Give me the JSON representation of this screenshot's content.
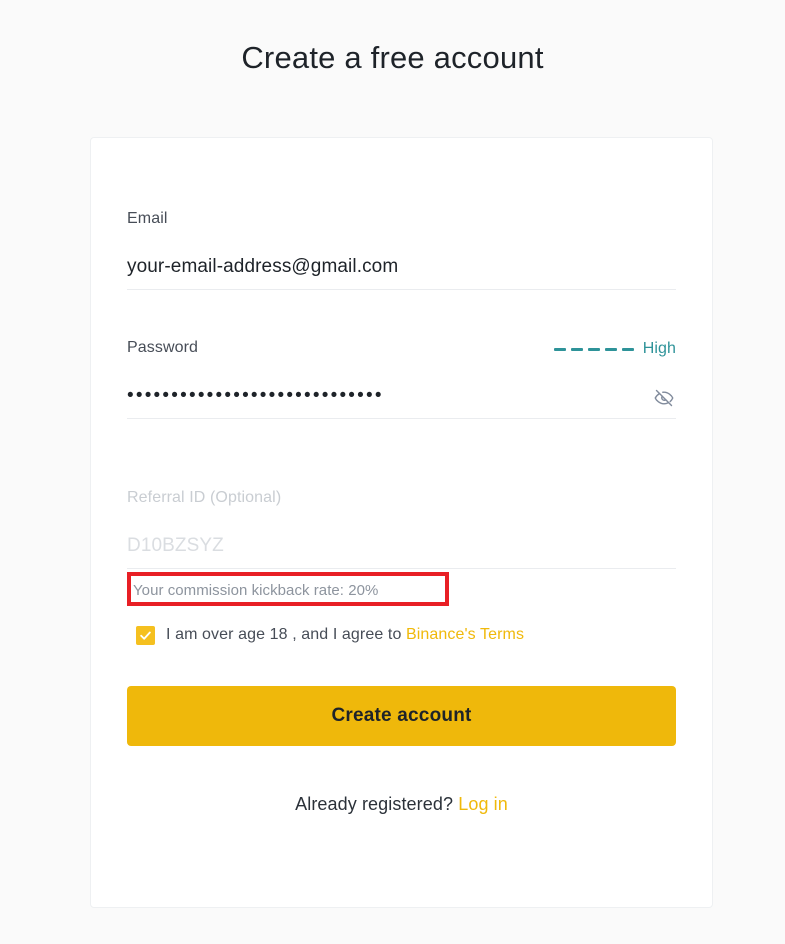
{
  "page": {
    "title": "Create a free account",
    "background_color": "#fafafa"
  },
  "form": {
    "email": {
      "label": "Email",
      "value": "your-email-address@gmail.com",
      "placeholder": "Email"
    },
    "password": {
      "label": "Password",
      "value": "•••••••••••••••••••••••••••••",
      "placeholder": "Password",
      "strength_label": "High",
      "strength_segments": 5,
      "strength_color": "#2e9399",
      "toggle_icon": "eye-off-icon"
    },
    "referral": {
      "label": "Referral ID (Optional)",
      "value": "D10BZSYZ",
      "placeholder": "Referral ID (Optional)",
      "kickback_note": "Your commission kickback rate: 20%",
      "kickback_rate": "20%"
    },
    "agreement": {
      "checked": true,
      "text_before": "I am over age 18 , and I agree to",
      "link_text": "Binance's Terms"
    },
    "submit_label": "Create account"
  },
  "footer": {
    "prompt": "Already registered?",
    "link_text": "Log in"
  },
  "annotation": {
    "color": "#e81f25",
    "target": "kickback-note"
  },
  "colors": {
    "brand_yellow": "#f0b90b",
    "button_yellow": "#efb80b",
    "checkbox_yellow": "#f5c01f",
    "teal": "#2e9399",
    "text_dark": "#1e2329",
    "text_muted": "#8d949e",
    "placeholder_gray": "#dadde1",
    "annotation_red": "#e81f25"
  }
}
